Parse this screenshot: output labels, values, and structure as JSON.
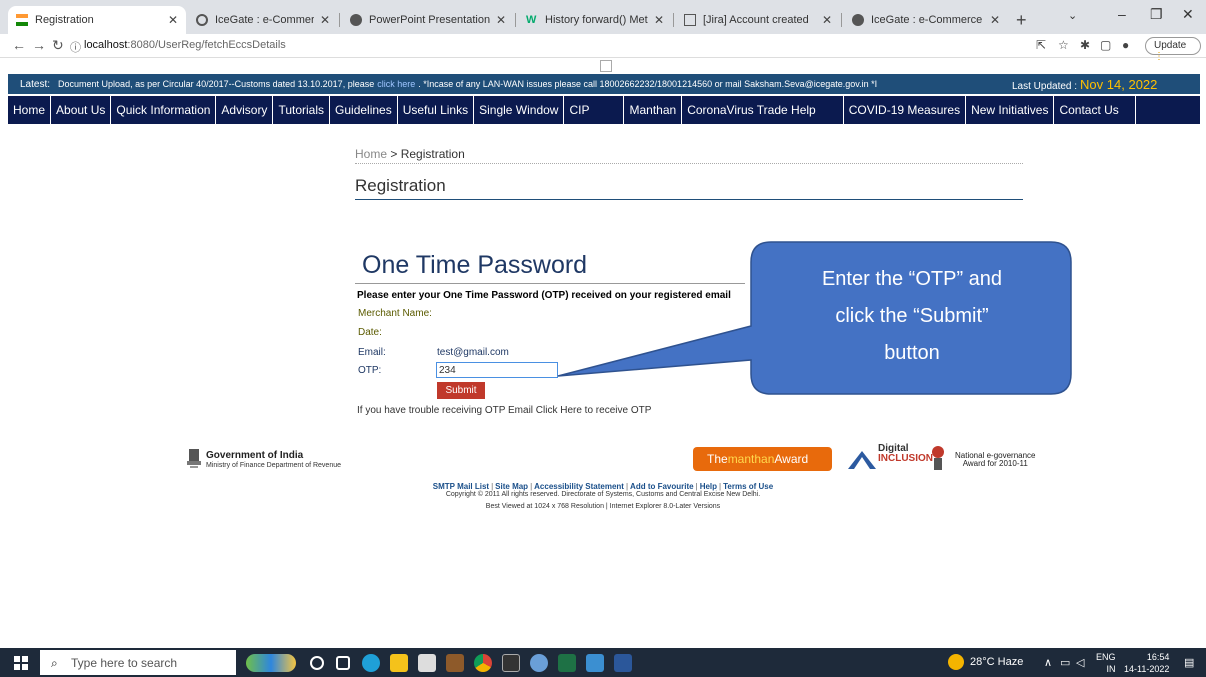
{
  "browser": {
    "tabs": [
      {
        "label": "Registration",
        "icon": "india-flag-icon",
        "active": true
      },
      {
        "label": "IceGate : e-Commerce Portal",
        "icon": "globe-icon"
      },
      {
        "label": "PowerPoint Presentation",
        "icon": "globe-icon"
      },
      {
        "label": "History forward() Method",
        "icon": "w3schools-icon"
      },
      {
        "label": "[Jira] Account created",
        "icon": "mail-icon"
      },
      {
        "label": "IceGate : e-Commerce Portal",
        "icon": "globe-icon"
      }
    ],
    "url_host": "localhost",
    "url_path": ":8080/UserReg/fetchEccsDetails",
    "update_label": "Update"
  },
  "ticker": {
    "label": "Latest:",
    "message1": "Document Upload, as per Circular 40/2017--Customs dated 13.10.2017, please",
    "click_text": "click here",
    "message2": ". *Incase of any LAN-WAN issues please call 18002662232/18001214560 or mail Saksham.Seva@icegate.gov.in *I",
    "last_updated_label": "Last Updated :",
    "last_updated_date": "Nov 14, 2022"
  },
  "menu": [
    "Home",
    "About Us",
    "Quick Information",
    "Advisory",
    "Tutorials",
    "Guidelines",
    "Useful Links",
    "Single Window",
    "CIP",
    "Manthan",
    "CoronaVirus Trade Help",
    "COVID-19 Measures",
    "New Initiatives",
    "Contact Us"
  ],
  "breadcrumb": {
    "home": "Home",
    "sep": ">",
    "current": "Registration"
  },
  "page_title": "Registration",
  "otp": {
    "title": "One Time Password",
    "instruction": "Please enter your One Time Password (OTP) received on your registered email",
    "merchant_label": "Merchant Name:",
    "date_label": "Date:",
    "email_label": "Email:",
    "email_value": "test@gmail.com",
    "otp_label": "OTP:",
    "otp_value": "234",
    "submit_label": "Submit",
    "trouble_text": "If you have trouble receiving OTP Email Click Here to receive OTP"
  },
  "callout": {
    "lines": [
      "Enter the “OTP” and",
      "click the “Submit”",
      "button"
    ],
    "color": "#4472c4"
  },
  "footer": {
    "gov_name": "Government of India",
    "gov_ministry": "Ministry of Finance Department of Revenue",
    "award1_prefix": "The",
    "award1_mid": "manthan",
    "award1_suffix": "Award",
    "award3_line1": "Digital",
    "award3_line2": "INCLUSION",
    "award4_line1": "National e-governance",
    "award4_line2": "Award for 2010-11",
    "links": [
      "SMTP Mail List",
      "Site Map",
      "Accessibility Statement",
      "Add to Favourite",
      "Help",
      "Terms of Use"
    ],
    "copyright": "Copyright © 2011 All rights reserved. Directorate of Systems, Customs and Central Excise New Delhi.",
    "best_viewed": "Best Viewed at 1024 x 768 Resolution | Internet Explorer 8.0-Later Versions"
  },
  "taskbar": {
    "search_placeholder": "Type here to search",
    "weather": "28°C Haze",
    "lang": "ENG",
    "region": "IN",
    "time": "16:54",
    "date": "14-11-2022"
  },
  "colors": {
    "ticker_bg": "#1f4e79",
    "menu_bg": "#0b1a4f",
    "submit_bg": "#c0392b",
    "callout_bg": "#4472c4"
  }
}
